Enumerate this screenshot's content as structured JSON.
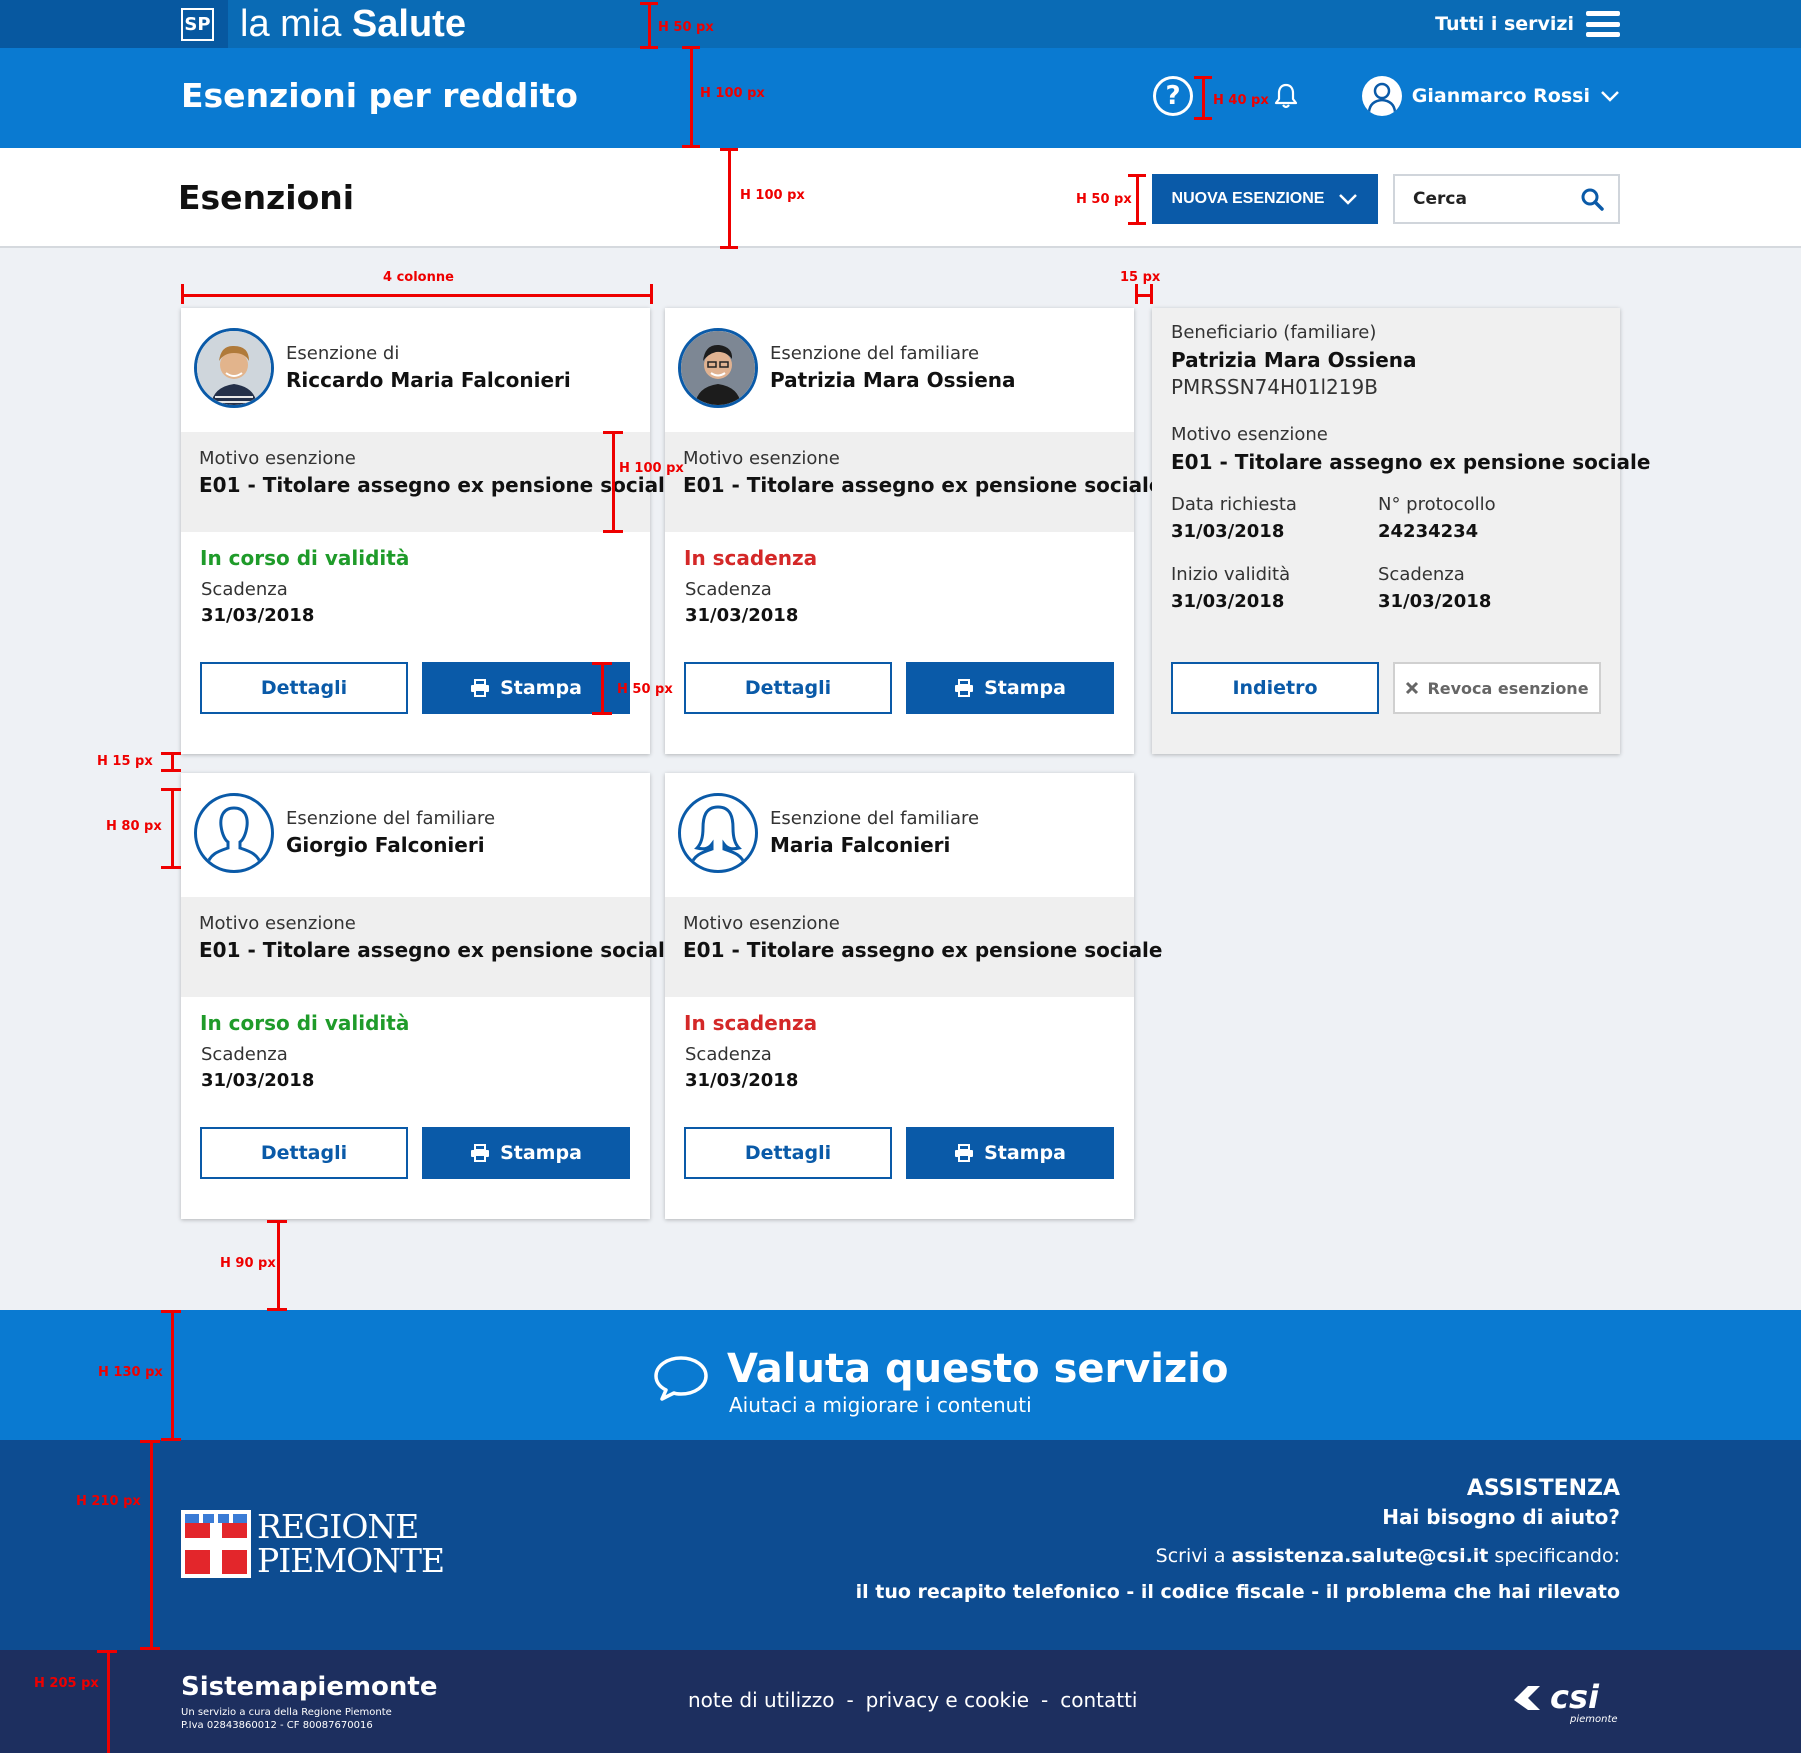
{
  "topbar": {
    "badge": "SP",
    "brand_light": "la mia ",
    "brand_bold": "Salute",
    "all_services": "Tutti i servizi"
  },
  "header": {
    "title": "Esenzioni per reddito",
    "help_symbol": "?",
    "user_name": "Gianmarco Rossi"
  },
  "titlebar": {
    "title": "Esenzioni",
    "new_button": "NUOVA ESENZIONE",
    "search_placeholder": "Cerca"
  },
  "cards": [
    {
      "label": "Esenzione di",
      "name": "Riccardo Maria Falconieri",
      "motivo_label": "Motivo esenzione",
      "motivo_code": "E01",
      "motivo_text": " - Titolare assegno ex pensione sociale",
      "status": "In corso di validità",
      "scadenza_label": "Scadenza",
      "scadenza": "31/03/2018",
      "details_btn": "Dettagli",
      "print_btn": "Stampa"
    },
    {
      "label": "Esenzione del familiare",
      "name": "Patrizia Mara Ossiena",
      "motivo_label": "Motivo esenzione",
      "motivo_code": "E01",
      "motivo_text": " - Titolare assegno ex pensione sociale",
      "status": "In scadenza",
      "scadenza_label": "Scadenza",
      "scadenza": "31/03/2018",
      "details_btn": "Dettagli",
      "print_btn": "Stampa"
    },
    {
      "label": "Esenzione del familiare",
      "name": "Giorgio Falconieri",
      "motivo_label": "Motivo esenzione",
      "motivo_code": "E01",
      "motivo_text": " - Titolare assegno ex pensione sociale",
      "status": "In corso di validità",
      "scadenza_label": "Scadenza",
      "scadenza": "31/03/2018",
      "details_btn": "Dettagli",
      "print_btn": "Stampa"
    },
    {
      "label": "Esenzione del familiare",
      "name": "Maria Falconieri",
      "motivo_label": "Motivo esenzione",
      "motivo_code": "E01",
      "motivo_text": " - Titolare assegno ex pensione sociale",
      "status": "In scadenza",
      "scadenza_label": "Scadenza",
      "scadenza": "31/03/2018",
      "details_btn": "Dettagli",
      "print_btn": "Stampa"
    }
  ],
  "detail": {
    "beneficiario_label": "Beneficiario  (familiare)",
    "name": "Patrizia Mara Ossiena",
    "cf": "PMRSSN74H01l219B",
    "motivo_label": "Motivo esenzione",
    "motivo_value": "E01 - Titolare assegno ex pensione sociale",
    "data_richiesta_label": "Data richiesta",
    "data_richiesta": "31/03/2018",
    "protocollo_label": "N° protocollo",
    "protocollo": "24234234",
    "inizio_label": "Inizio validità",
    "inizio": "31/03/2018",
    "scadenza_label": "Scadenza",
    "scadenza": "31/03/2018",
    "back_btn": "Indietro",
    "revoca_btn": "Revoca esenzione"
  },
  "feedback": {
    "title": "Valuta questo servizio",
    "subtitle": "Aiutaci a migiorare i contenuti"
  },
  "footer": {
    "regione_line1": "REGIONE",
    "regione_line2": "PIEMONTE",
    "assist_title": "ASSISTENZA",
    "assist_question": "Hai bisogno di aiuto?",
    "write_prefix": "Scrivi a ",
    "email": "assistenza.salute@csi.it",
    "write_suffix": " specificando:",
    "requirements": "il tuo recapito telefonico - il codice fiscale - il problema che hai rilevato"
  },
  "bottom": {
    "brand": "Sistemapiemonte",
    "small_line1": "Un servizio a cura della Regione Piemonte",
    "small_line2": "P.Iva 02843860012 - CF 80087670016",
    "link_notes": "note di utilizzo",
    "link_privacy": "privacy e cookie",
    "link_contacts": "contatti",
    "separator": "-",
    "csi_logo": "csi",
    "csi_sub": "piemonte"
  },
  "annotations": {
    "a1": "H 50 px",
    "a2": "H 100 px",
    "a3": "H 40 px",
    "a4": "H 100 px",
    "a5": "H 50 px",
    "a6": "4 colonne",
    "a7": "15 px",
    "a8": "H 100 px",
    "a9": "H 50 px",
    "a10": "H 15 px",
    "a11": "H 80 px",
    "a12": "H 90 px",
    "a13": "H 130 px",
    "a14": "H 210 px",
    "a15": "H 205 px"
  },
  "colors": {
    "primary": "#0a5aa8",
    "header_blue": "#0a7ad1",
    "footer_blue": "#0d4c91",
    "bottom_navy": "#1d2f5f",
    "valid_green": "#1f9b2a",
    "expiring_red": "#d42828"
  }
}
